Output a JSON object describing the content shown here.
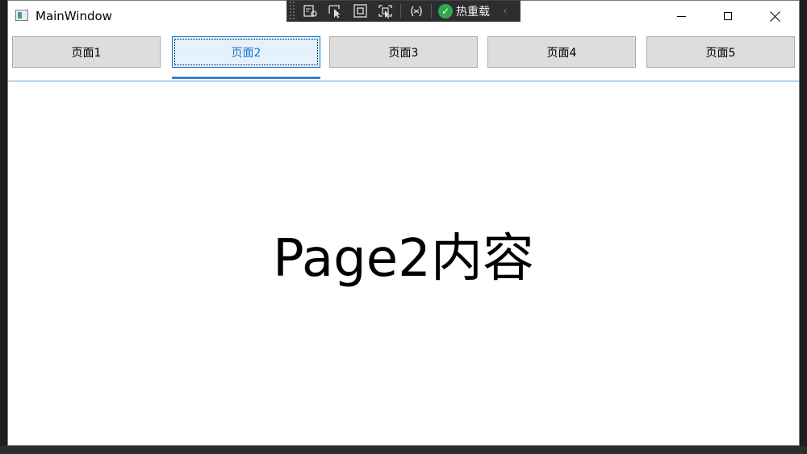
{
  "window": {
    "title": "MainWindow"
  },
  "debug_toolbar": {
    "icons": [
      "select-element-icon",
      "pointer-select-icon",
      "display-adorner-icon",
      "track-focus-icon",
      "binding-failures-icon"
    ],
    "hot_reload_label": "热重载",
    "hot_reload_status": "ok"
  },
  "nav": {
    "buttons": [
      {
        "label": "页面1",
        "active": false
      },
      {
        "label": "页面2",
        "active": true
      },
      {
        "label": "页面3",
        "active": false
      },
      {
        "label": "页面4",
        "active": false
      },
      {
        "label": "页面5",
        "active": false
      }
    ]
  },
  "content": {
    "text": "Page2内容"
  },
  "colors": {
    "accent": "#0078d7",
    "active_text": "#1a73c9",
    "button_bg": "#dddddd",
    "hot_reload_ok": "#2fa84f"
  }
}
